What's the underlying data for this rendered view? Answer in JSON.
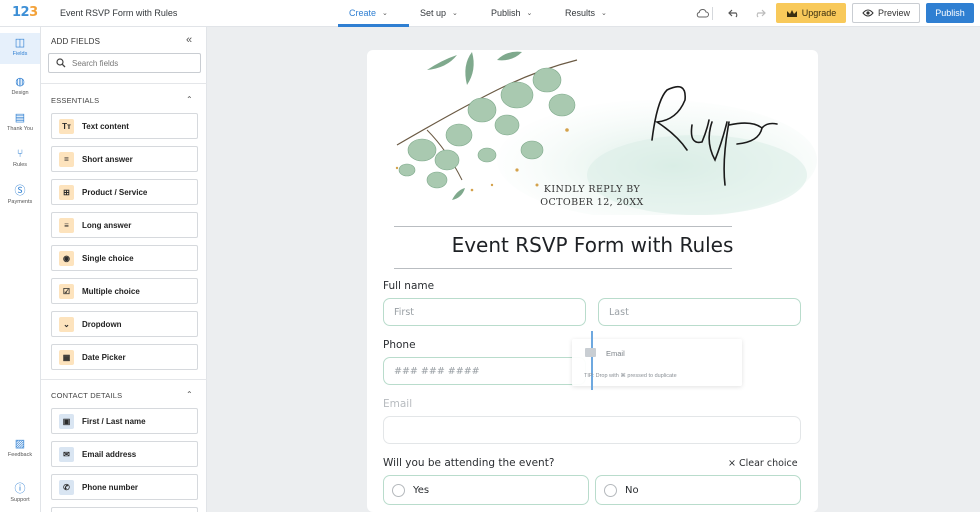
{
  "app": {
    "logo_main": "12",
    "logo_accent": "3",
    "form_title": "Event RSVP Form with Rules"
  },
  "nav": {
    "tabs": [
      {
        "label": "Create",
        "active": true
      },
      {
        "label": "Set up"
      },
      {
        "label": "Publish"
      },
      {
        "label": "Results"
      }
    ],
    "upgrade_label": "Upgrade",
    "preview_label": "Preview",
    "publish_label": "Publish",
    "icons": [
      "cloud-icon",
      "undo-icon",
      "redo-icon",
      "crown-icon",
      "eye-icon"
    ]
  },
  "rail": {
    "items": [
      {
        "label": "Fields",
        "icon": "fields-icon",
        "active": true
      },
      {
        "label": "Design",
        "icon": "palette-icon"
      },
      {
        "label": "Thank You",
        "icon": "thank-you-icon"
      },
      {
        "label": "Rules",
        "icon": "rules-icon"
      },
      {
        "label": "Payments",
        "icon": "dollar-icon"
      },
      {
        "label": "Feedback",
        "icon": "feedback-icon"
      },
      {
        "label": "Support",
        "icon": "help-icon"
      }
    ]
  },
  "panel": {
    "title": "ADD FIELDS",
    "search_placeholder": "Search fields",
    "essentials_title": "ESSENTIALS",
    "essentials": [
      {
        "label": "Text content",
        "icon": "text-icon",
        "glyph": "Tт"
      },
      {
        "label": "Short answer",
        "icon": "short-answer-icon",
        "glyph": "="
      },
      {
        "label": "Product / Service",
        "icon": "cart-icon",
        "glyph": "⊞"
      },
      {
        "label": "Long answer",
        "icon": "long-answer-icon",
        "glyph": "≡"
      },
      {
        "label": "Single choice",
        "icon": "radio-icon",
        "glyph": "◉"
      },
      {
        "label": "Multiple choice",
        "icon": "checkbox-icon",
        "glyph": "☑"
      },
      {
        "label": "Dropdown",
        "icon": "dropdown-icon",
        "glyph": "⌄"
      },
      {
        "label": "Date Picker",
        "icon": "calendar-icon",
        "glyph": "▦"
      }
    ],
    "contact_title": "CONTACT DETAILS",
    "contact": [
      {
        "label": "First / Last name",
        "icon": "name-icon",
        "glyph": "▣"
      },
      {
        "label": "Email address",
        "icon": "email-icon",
        "glyph": "✉"
      },
      {
        "label": "Phone number",
        "icon": "phone-icon",
        "glyph": "✆"
      }
    ]
  },
  "form": {
    "rsvp_script": "Rsvp",
    "kindly_line1": "KINDLY REPLY BY",
    "kindly_line2": "OCTOBER 12, 20XX",
    "title": "Event RSVP Form with Rules",
    "full_name_label": "Full name",
    "first_placeholder": "First",
    "last_placeholder": "Last",
    "phone_label": "Phone",
    "phone_placeholder": "### ### ####",
    "email_label": "Email",
    "attend_label": "Will you be attending the event?",
    "clear_choice": "× Clear choice",
    "options": [
      "Yes",
      "No"
    ]
  },
  "drag_preview": {
    "label": "Email",
    "tip": "TIP: Drop with ⌘ pressed to duplicate"
  },
  "colors": {
    "accent": "#2f7fd2",
    "upgrade": "#f8c95a",
    "field_border": "#b9dccc"
  }
}
